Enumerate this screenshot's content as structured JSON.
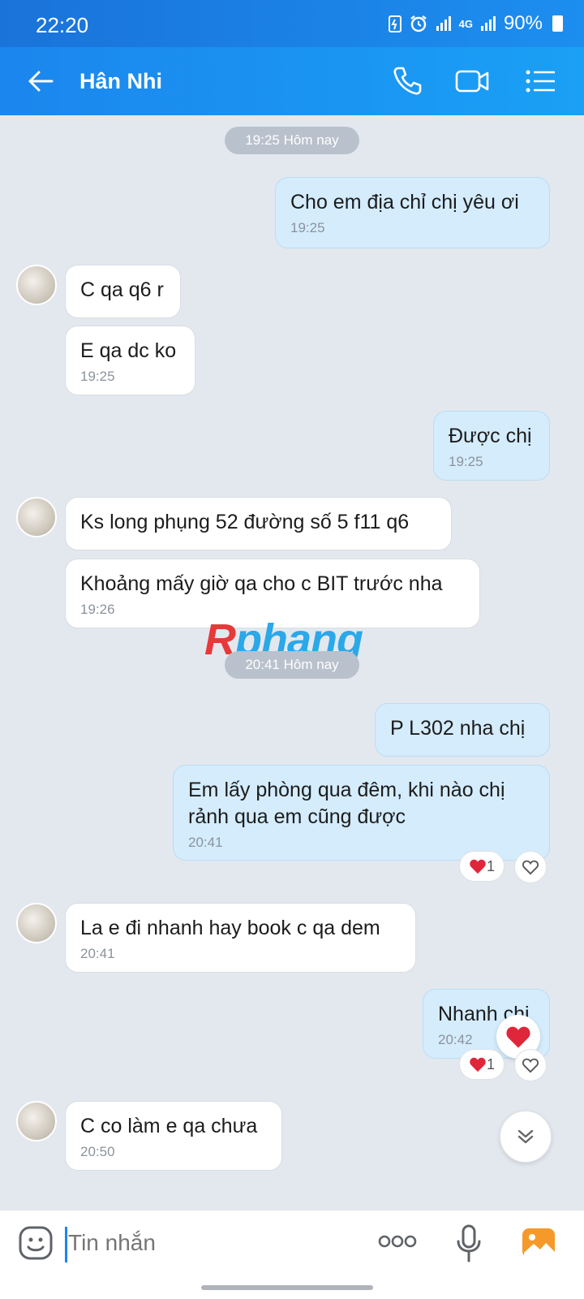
{
  "status_bar": {
    "time": "22:20",
    "network": "4G",
    "battery": "90%"
  },
  "header": {
    "contact_name": "Hân Nhi",
    "icons": [
      "back-arrow-icon",
      "phone-icon",
      "video-call-icon",
      "menu-list-icon"
    ]
  },
  "chat": {
    "separators": [
      "19:25 Hôm nay",
      "20:41 Hôm nay"
    ],
    "messages": [
      {
        "dir": "out",
        "text": "Cho em địa chỉ chị yêu ơi",
        "time": "19:25"
      },
      {
        "dir": "in",
        "text": "C qa q6 r",
        "time": ""
      },
      {
        "dir": "in",
        "text": "E qa dc ko",
        "time": "19:25"
      },
      {
        "dir": "out",
        "text": "Được chị",
        "time": "19:25"
      },
      {
        "dir": "in",
        "text": "Ks long phụng 52 đường số 5 f11 q6",
        "time": ""
      },
      {
        "dir": "in",
        "text": "Khoảng mấy giờ qa cho c BIT trước nha",
        "time": "19:26"
      },
      {
        "dir": "out",
        "text": "P L302 nha chị",
        "time": ""
      },
      {
        "dir": "out",
        "text": "Em lấy phòng qua đêm, khi nào chị rảnh qua em cũng được",
        "time": "20:41",
        "reaction_count": "1"
      },
      {
        "dir": "in",
        "text": "La e đi nhanh hay book c qa dem",
        "time": "20:41"
      },
      {
        "dir": "out",
        "text": "Nhanh chị",
        "time": "20:42",
        "reaction_count": "1"
      },
      {
        "dir": "in",
        "text": "C co làm e qa chưa",
        "time": "20:50"
      }
    ]
  },
  "watermark": {
    "part1": "R",
    "part2": "phang"
  },
  "input": {
    "placeholder": "Tin nhắn"
  },
  "colors": {
    "header": "#1b86ee",
    "outgoing_bubble": "#d4ecfc",
    "incoming_bubble": "#ffffff",
    "background": "#e3e8ef",
    "heart": "#e0263a"
  }
}
